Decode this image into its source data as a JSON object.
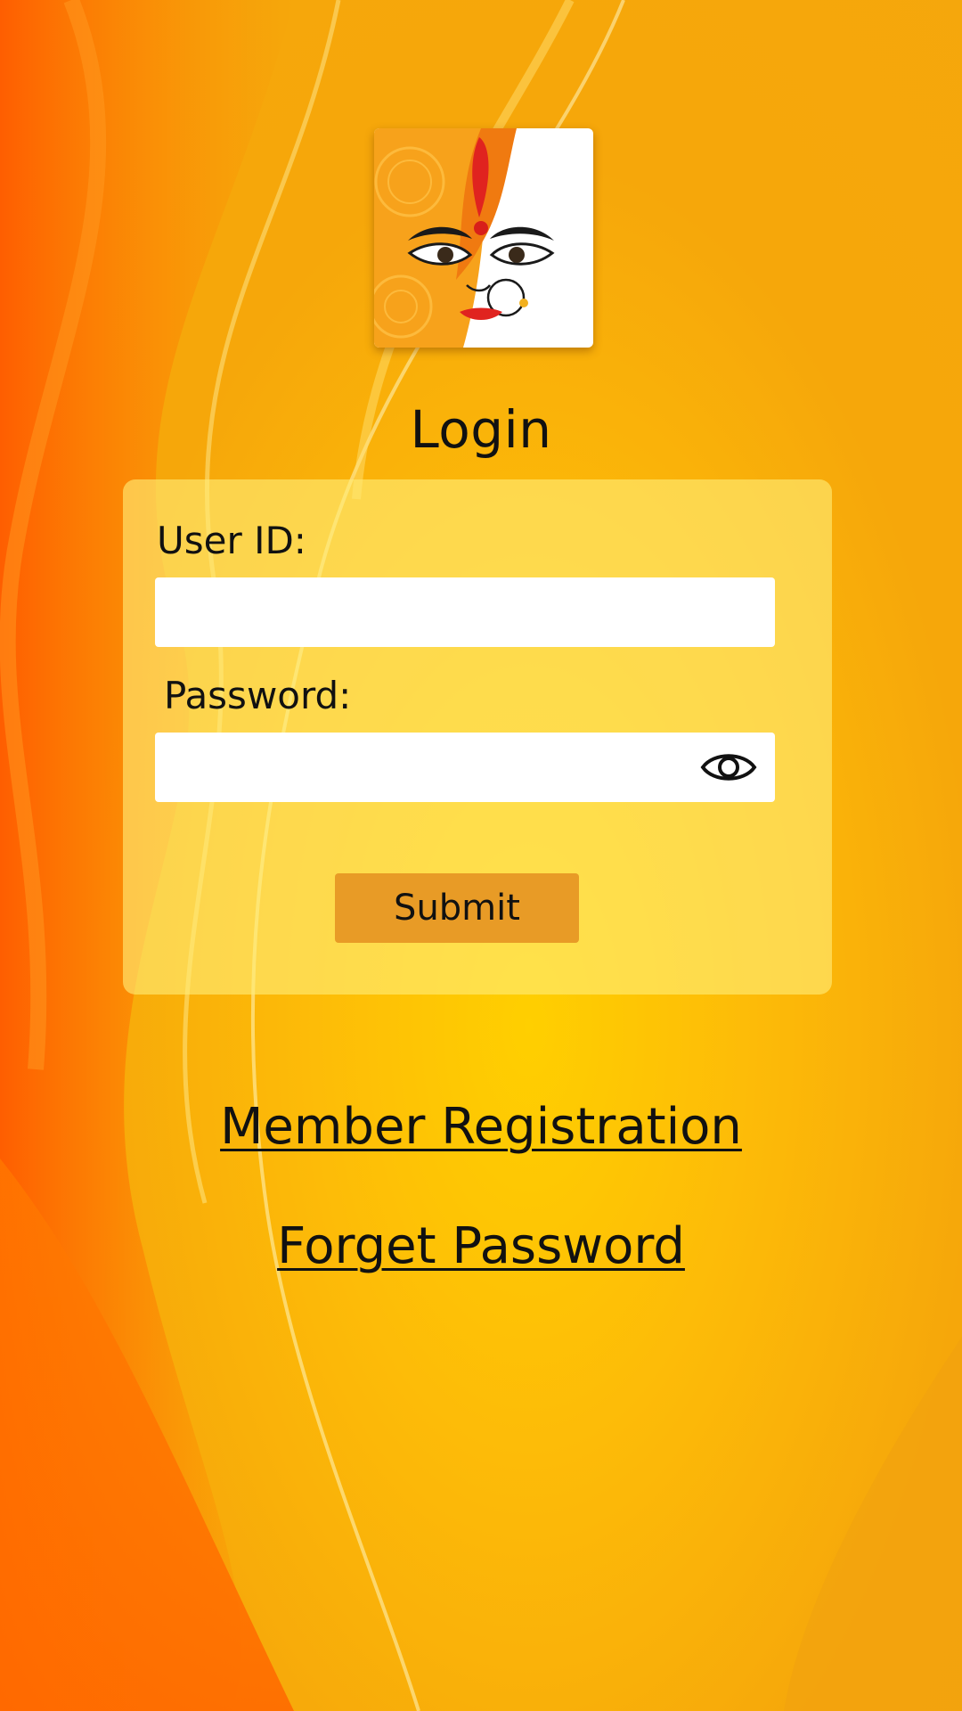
{
  "colors": {
    "background": "#fdbb08",
    "flame_orange": "#ff6a00",
    "card": "#ffee78",
    "submit": "#e89b26",
    "input": "#ffffff",
    "text": "#111111"
  },
  "logo": {
    "icon": "goddess-face-logo"
  },
  "login": {
    "title": "Login",
    "user_id_label": "User ID:",
    "user_id_value": "",
    "password_label": "Password:",
    "password_value": "",
    "show_password_icon": "eye-icon",
    "submit_label": "Submit"
  },
  "links": {
    "member_registration": "Member Registration",
    "forget_password": "Forget Password"
  }
}
